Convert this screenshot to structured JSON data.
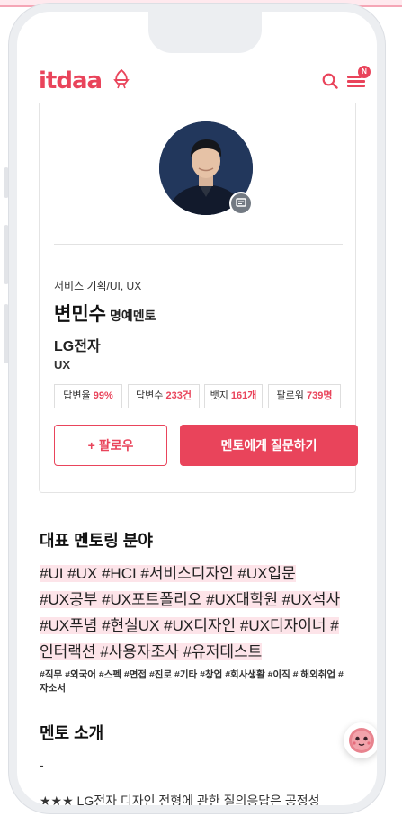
{
  "header": {
    "logo": "itdaa",
    "notification_badge": "N"
  },
  "profile": {
    "field": "서비스 기획/UI, UX",
    "name": "변민수",
    "mentor_type": "명예멘토",
    "company": "LG전자",
    "job": "UX",
    "stats": [
      {
        "label": "답변율",
        "value": "99%"
      },
      {
        "label": "답변수",
        "value": "233건"
      },
      {
        "label": "뱃지",
        "value": "161개"
      },
      {
        "label": "팔로워",
        "value": "739명"
      }
    ],
    "follow_label": "+ 팔로우",
    "ask_label": "멘토에게 질문하기"
  },
  "mentoring": {
    "title": "대표 멘토링 분야",
    "tag_lines": [
      "#UI #UX #HCI #서비스디자인 #UX입문",
      "#UX공부 #UX포트폴리오 #UX대학원 #UX석사",
      "#UX푸념 #현실UX #UX디자인 #UX디자이너 #",
      "인터랙션 #사용자조사 #유저테스트"
    ],
    "sub_tags": "#직무 #외국어 #스펙 #면접 #진로 #기타 #창업 #회사생활 #이직 # 해외취업 #자소서"
  },
  "intro": {
    "title": "멘토 소개",
    "dash": "-",
    "text": "★★★ LG전자 디자인 전형에 관한 질의응답은 공정성"
  },
  "colors": {
    "brand": "#e9445b",
    "highlight": "#fde4e9"
  }
}
